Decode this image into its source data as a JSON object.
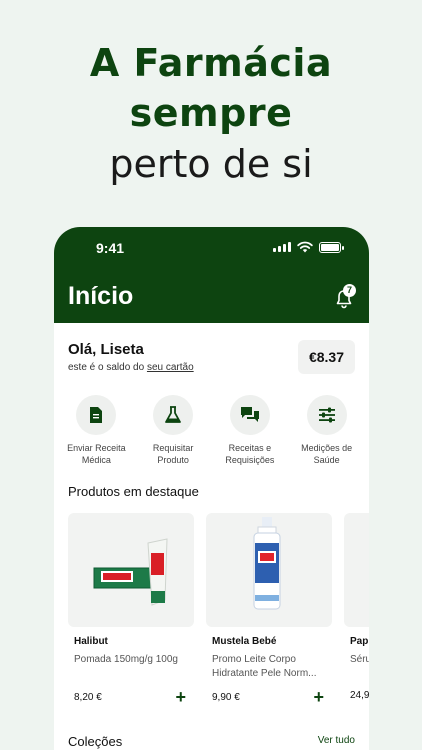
{
  "hero": {
    "line1": "A Farmácia",
    "line2": "sempre",
    "line3": "perto de si"
  },
  "status_bar": {
    "time": "9:41"
  },
  "header": {
    "title": "Início",
    "notification_count": "7"
  },
  "greeting": {
    "hello": "Olá, Liseta",
    "subtitle_prefix": "este é o saldo do ",
    "subtitle_link": "seu cartão",
    "balance": "€8.37"
  },
  "actions": [
    {
      "line1": "Enviar Receita",
      "line2": "Médica",
      "icon": "document-icon"
    },
    {
      "line1": "Requisitar",
      "line2": "Produto",
      "icon": "flask-icon"
    },
    {
      "line1": "Receitas e",
      "line2": "Requisições",
      "icon": "chat-icon"
    },
    {
      "line1": "Medições de",
      "line2": "Saúde",
      "icon": "sliders-icon"
    }
  ],
  "featured": {
    "title": "Produtos em destaque",
    "products": [
      {
        "name": "Halibut",
        "desc": "Pomada 150mg/g 100g",
        "price": "8,20 €"
      },
      {
        "name": "Mustela Bebé",
        "desc": "Promo Leite Corpo Hidratante Pele Norm...",
        "price": "9,90 €"
      },
      {
        "name": "Papi",
        "desc": "Séru",
        "price": "24,9"
      }
    ]
  },
  "collections": {
    "title": "Coleções",
    "see_all": "Ver tudo"
  },
  "colors": {
    "brand_green": "#0d4410",
    "background": "#eef4f0"
  }
}
